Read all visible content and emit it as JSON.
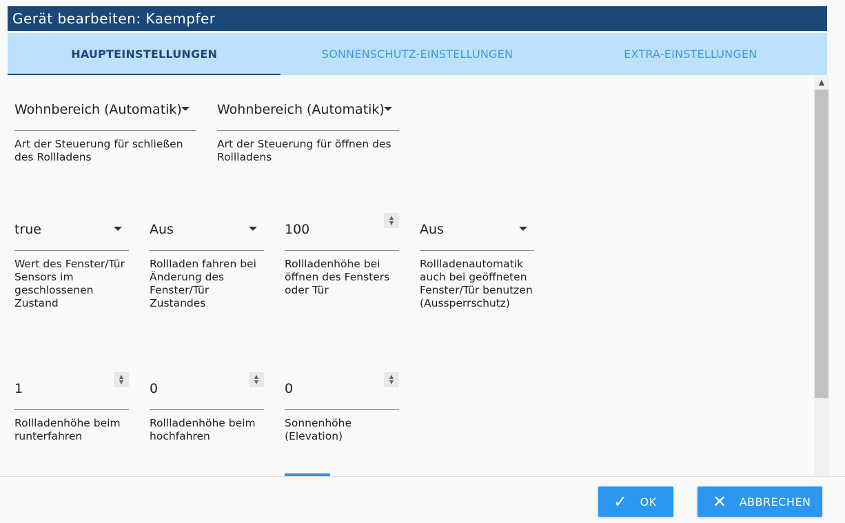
{
  "window": {
    "title": "Gerät bearbeiten: Kaempfer"
  },
  "tabs": [
    {
      "label": "HAUPTEINSTELLUNGEN",
      "active": true
    },
    {
      "label": "SONNENSCHUTZ-EINSTELLUNGEN",
      "active": false
    },
    {
      "label": "EXTRA-EINSTELLUNGEN",
      "active": false
    }
  ],
  "fields": {
    "close_mode": {
      "value": "Wohnbereich (Automatik)",
      "label": "Art der Steuerung für schließen des Rollladens"
    },
    "open_mode": {
      "value": "Wohnbereich (Automatik)",
      "label": "Art der Steuerung für öffnen des Rollladens"
    },
    "sensor_value": {
      "value": "true",
      "label": "Wert des Fenster/Tür Sensors im geschlossenen Zustand"
    },
    "drive_on_change": {
      "value": "Aus",
      "label": "Rollladen fahren bei Änderung des Fenster/Tür Zustandes"
    },
    "height_open_window": {
      "value": "100",
      "label": "Rollladenhöhe bei öffnen des Fensters oder Tür"
    },
    "lockout": {
      "value": "Aus",
      "label": "Rollladenautomatik auch bei geöffneten Fenster/Tür benutzen (Aussperrschutz)"
    },
    "height_down": {
      "value": "1",
      "label": "Rollladenhöhe beim runterfahren"
    },
    "height_up": {
      "value": "0",
      "label": "Rollladenhöhe beim hochfahren"
    },
    "elevation": {
      "value": "0",
      "label": "Sonnenhöhe (Elevation)"
    }
  },
  "footer": {
    "ok_label": "OK",
    "cancel_label": "ABBRECHEN"
  },
  "icons": {
    "ok": "check-icon",
    "cancel": "close-icon",
    "dropdown": "caret-down-icon",
    "spinner": "spinner-icon"
  },
  "colors": {
    "titlebar": "#1b4878",
    "tabs_bg": "#bde0fb",
    "accent": "#2c97ee"
  }
}
